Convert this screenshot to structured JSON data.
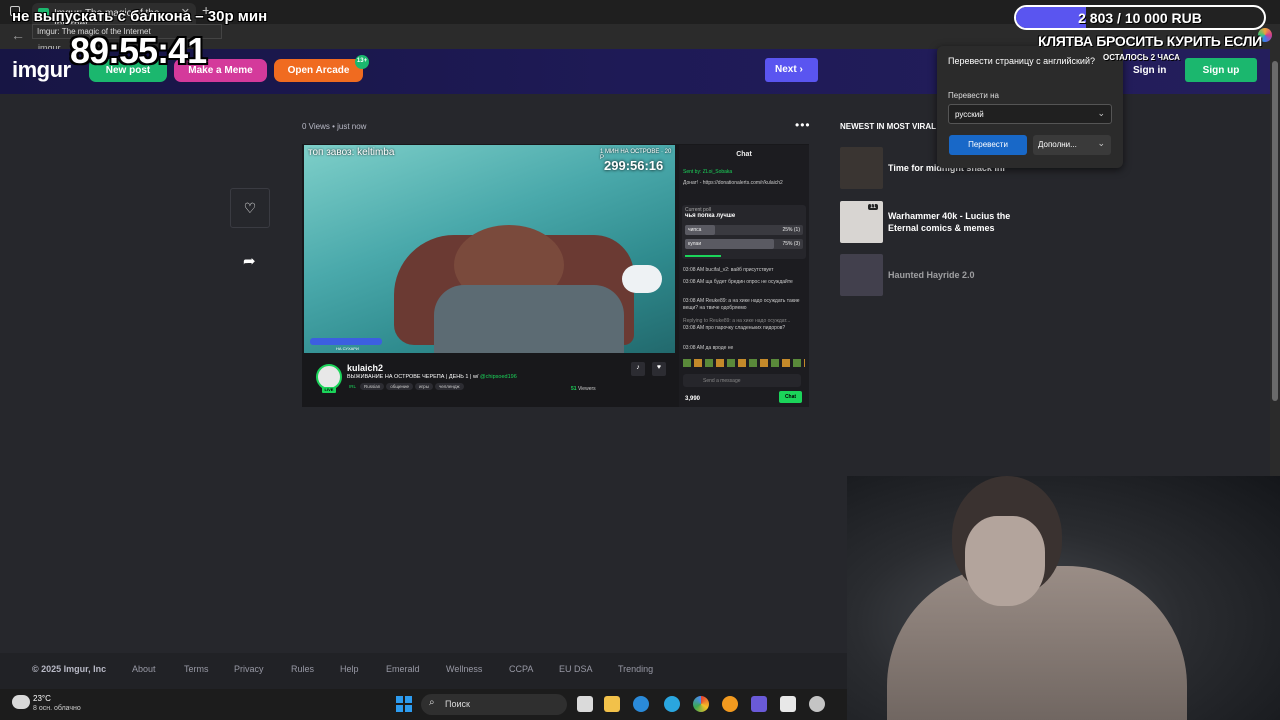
{
  "browser": {
    "tab_title": "Imgur: The magic of the Internet",
    "tooltip": "Imgur: The magic of the Internet",
    "url_fragment": "imgur"
  },
  "header": {
    "logo": "imgur",
    "new_post": "New post",
    "make_meme": "Make a Meme",
    "open_arcade": "Open Arcade",
    "arcade_badge": "13+",
    "next": "Next",
    "sign_in": "Sign in",
    "sign_up": "Sign up"
  },
  "post": {
    "meta": "0 Views • just now",
    "video": {
      "top_text": "топ завоз: keltimba",
      "day_text": "1 МИН НА ОСТРОВЕ · 20 Р",
      "timer": "299:56:16",
      "bar_text": "НА СУХАРИ"
    },
    "chat": {
      "title": "Chat",
      "sent_by": "Sent by: ZLoi_Sobaka",
      "donate": "Донат! - https://donationalerts.com/r/kulaich2",
      "poll_label": "Current poll",
      "poll_question": "чья попка лучше",
      "poll_options": [
        {
          "label": "чипса",
          "pct": "25% (1)",
          "fraction": 0.25
        },
        {
          "label": "кулаи",
          "pct": "75% (3)",
          "fraction": 0.75
        }
      ],
      "messages": [
        "03:08 AM bucifal_v2: вайб присутствует",
        "03:08 AM ща будет бредин опрос не осуждайте",
        "03:08 AM Reuke89: а на хике надо осуждать такие вещи? на твичe одобряемо",
        "Replying to Reuke89: а на хике надо осуждат...",
        "03:08 AM про парочку сладеньких пидоров?",
        "03:08 AM да вроде не"
      ],
      "input_placeholder": "Send a message",
      "points": "3,990",
      "chat_button": "Chat"
    },
    "streamer": {
      "name": "kulaich2",
      "title": "ВЫЖИВАНИЕ НА ОСТРОВЕ ЧЕРЕПА | ДЕНЬ 1 | w/",
      "guest": "@chipsoed196",
      "live": "LIVE",
      "tags": [
        "IRL",
        "Russian",
        "общение",
        "игры",
        "челлендж"
      ],
      "viewers_count": "51",
      "viewers_label": "Viewers"
    }
  },
  "sidebar": {
    "heading": "NEWEST IN MOST VIRAL",
    "items": [
      {
        "title": "Time for midnight snack ini",
        "count": ""
      },
      {
        "title": "Warhammer 40k - Lucius the Eternal comics & memes",
        "count": "11"
      },
      {
        "title": "Haunted Hayride 2.0",
        "count": ""
      }
    ]
  },
  "translate_popup": {
    "title": "Перевести страницу с английский?",
    "label": "Перевести на",
    "selected": "русский",
    "translate_button": "Перевести",
    "more_button": "Дополни..."
  },
  "footer": {
    "copyright": "© 2025 Imgur, Inc",
    "links": [
      "About",
      "Terms",
      "Privacy",
      "Rules",
      "Help",
      "Emerald",
      "Wellness",
      "CCPA",
      "EU DSA",
      "Trending"
    ]
  },
  "taskbar": {
    "temp": "23°C",
    "weather": "8 осн. облачно",
    "search": "Поиск"
  },
  "overlay": {
    "top_text": "не выпускать с балкона – 30р мин",
    "timer": "89:55:41",
    "goal_text": "2 803 / 10 000 RUB",
    "goal_fraction": 0.2803,
    "vow": "КЛЯТВА БРОСИТЬ КУРИТЬ ЕСЛИ",
    "remaining": "ОСТАЛОСЬ 2 ЧАСА"
  },
  "colors": {
    "imgur_green": "#1bb76e",
    "meme_pink": "#d43a9b",
    "arcade_orange": "#f06b20",
    "next_purple": "#5a55f0",
    "edge_blue": "#1868c8"
  }
}
